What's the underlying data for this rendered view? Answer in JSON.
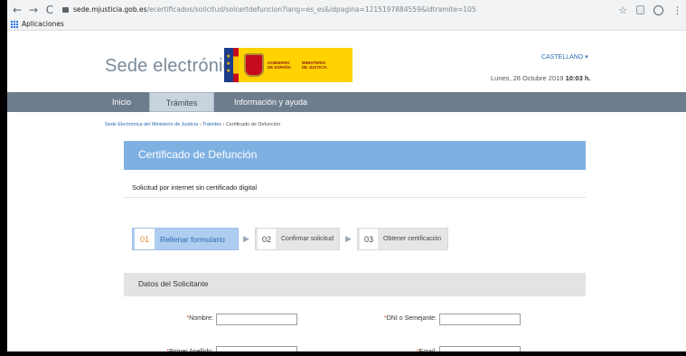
{
  "browser": {
    "url_host": "sede.mjusticia.gob.es",
    "url_path": "/ecertificados/solicitud/solcertdefuncion?lang=es_es&idpagina=1215197884559&idtramite=105",
    "bookmark_apps": "Aplicaciones",
    "back_glyph": "←",
    "forward_glyph": "→",
    "reload_glyph": "C",
    "star_glyph": "☆",
    "menu_glyph": "⋮"
  },
  "header": {
    "site_title": "Sede electrónica",
    "logo_gov_line1": "GOBIERNO",
    "logo_gov_line2": "DE ESPAÑA",
    "logo_min_line1": "MINISTERIO",
    "logo_min_line2": "DE JUSTICIA",
    "language": "CASTELLANO ▾",
    "date_prefix": "Lunes, 28 Octubre 2019",
    "time": "10:03 h."
  },
  "nav": {
    "items": [
      {
        "label": "Inicio"
      },
      {
        "label": "Trámites"
      },
      {
        "label": "Información y ayuda"
      }
    ]
  },
  "breadcrumb": {
    "item1": "Sede Electrónica del Ministerio de Justicia",
    "sep": "›",
    "item2": "Trámites",
    "item3": "Certificado de Defunción"
  },
  "page": {
    "title": "Certificado de Defunción",
    "subtitle": "Solicitud por internet sin certificado digital"
  },
  "steps": [
    {
      "num": "01",
      "label": "Rellenar formulario"
    },
    {
      "num": "02",
      "label": "Confirmar solicitud"
    },
    {
      "num": "03",
      "label": "Obtener certificación"
    }
  ],
  "step_arrow": "▶",
  "form": {
    "section_title": "Datos del Solicitante",
    "required_mark": "*",
    "fields": {
      "nombre": {
        "label": "Nombre:",
        "value": ""
      },
      "dni": {
        "label": "DNI o Semejante:",
        "value": ""
      },
      "apellido1": {
        "label": "Primer Apellido:",
        "value": ""
      },
      "email": {
        "label": "Email:",
        "value": ""
      }
    }
  }
}
